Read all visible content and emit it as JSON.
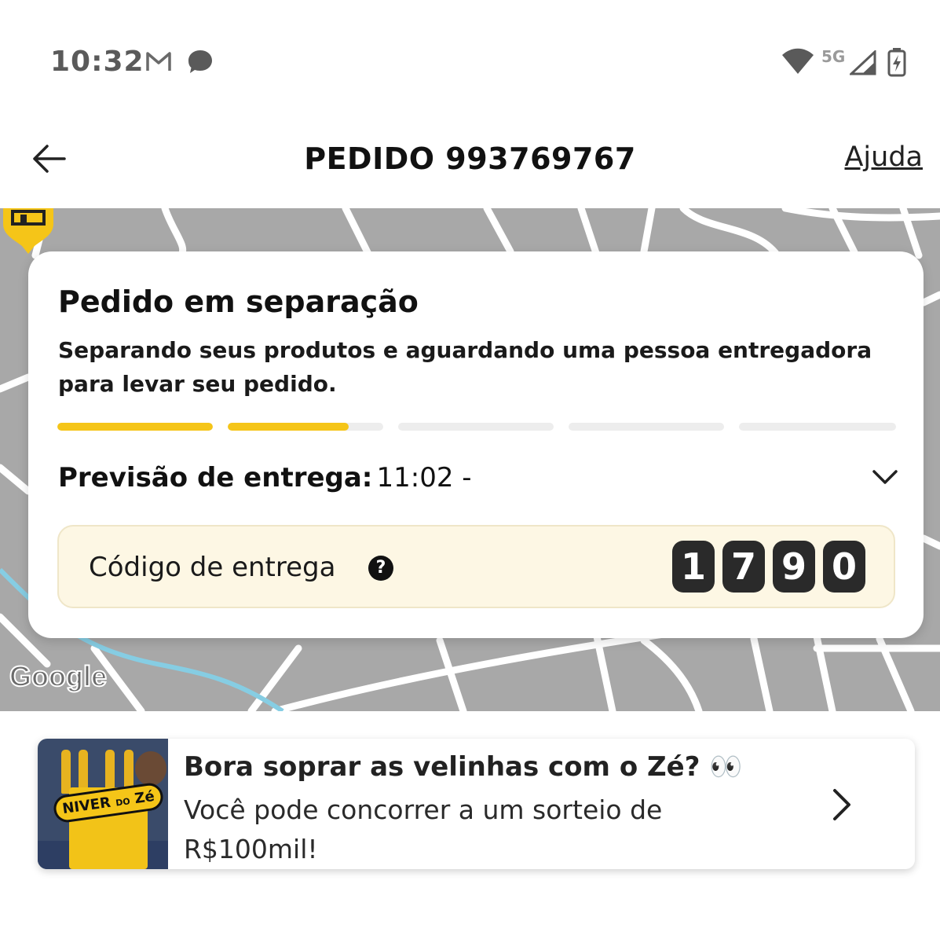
{
  "status_bar": {
    "time": "10:32",
    "network": "5G",
    "icons": [
      "gmail-icon",
      "chat-icon",
      "wifi-icon",
      "signal-icon",
      "battery-charging-icon"
    ]
  },
  "header": {
    "title": "PEDIDO 993769767",
    "help_label": "Ajuda",
    "back_icon": "arrow-left-icon"
  },
  "map": {
    "attribution": "Google",
    "pin_icon": "store-pin-icon"
  },
  "order_status": {
    "title": "Pedido em separação",
    "description": "Separando seus produtos e aguardando uma pessoa entregadora para levar seu pedido.",
    "progress": {
      "segments": 5,
      "fills": [
        1,
        0.78,
        0,
        0,
        0
      ],
      "accent_color": "#f5c518",
      "track_color": "#ededed"
    },
    "eta_label": "Previsão de entrega:",
    "eta_value": "11:02 -",
    "delivery_code_label": "Código de entrega",
    "delivery_code_help": "?",
    "delivery_code": [
      "1",
      "7",
      "9",
      "0"
    ]
  },
  "promo": {
    "image_badge_text": "NIVER",
    "image_badge_small": "DO",
    "image_badge_brand": "Zé",
    "title": "Bora soprar as velinhas com o Zé? 👀",
    "subtitle": "Você pode concorrer a um sorteio de R$100mil!",
    "chevron_icon": "chevron-right-icon"
  }
}
